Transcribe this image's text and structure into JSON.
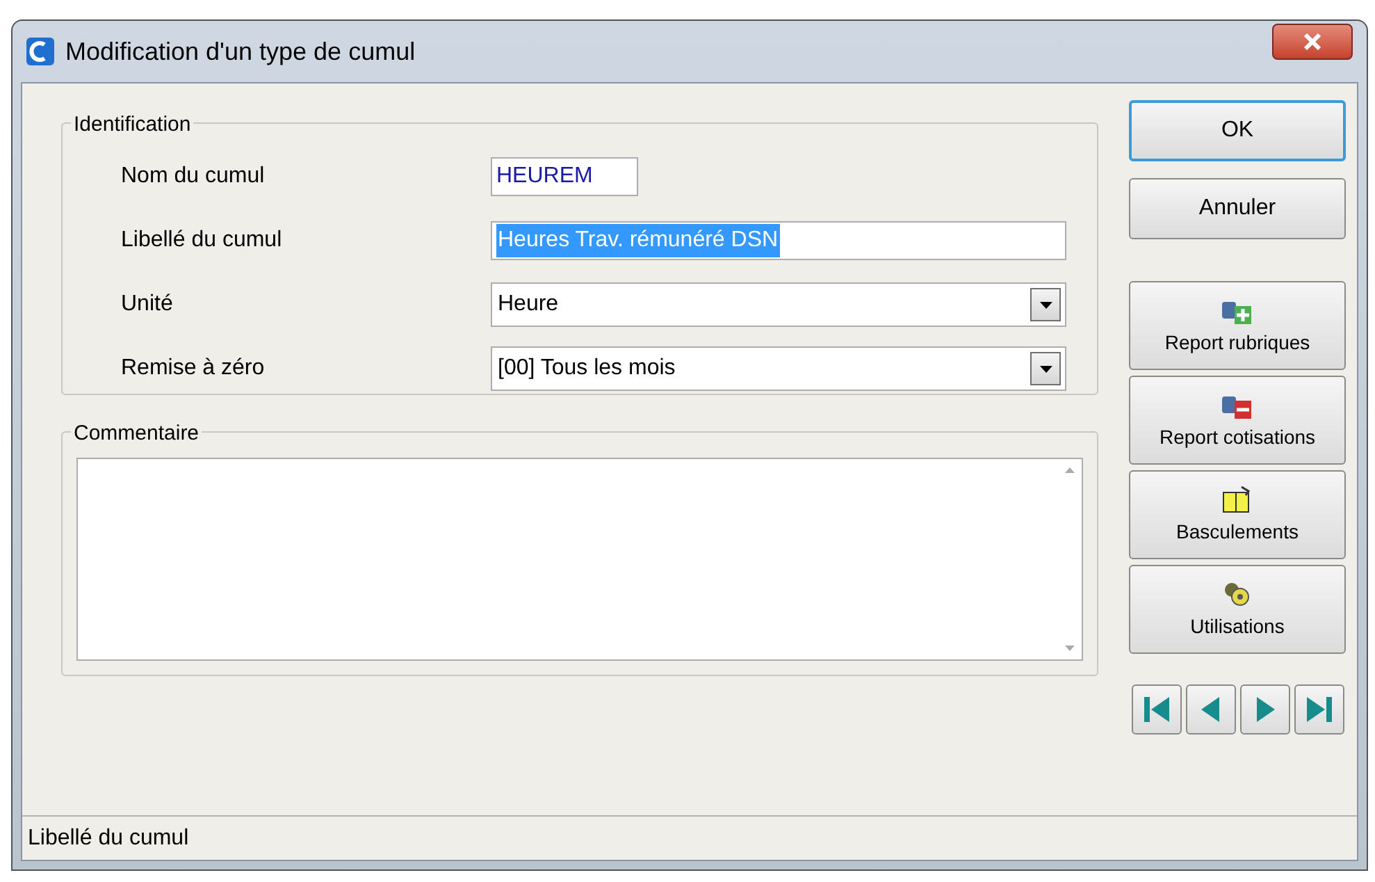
{
  "window": {
    "title": "Modification d'un type de cumul"
  },
  "identification": {
    "legend": "Identification",
    "fields": [
      {
        "kind": "text",
        "label": "Nom du cumul",
        "value": "HEUREM",
        "text_selected": false
      },
      {
        "kind": "text",
        "label": "Libellé du cumul",
        "value": "Heures Trav. rémunéré DSN",
        "text_selected": true
      },
      {
        "kind": "dropdown",
        "label": "Unité",
        "value": "Heure"
      },
      {
        "kind": "dropdown",
        "label": "Remise à zéro",
        "value": "[00] Tous les mois"
      }
    ]
  },
  "comment": {
    "legend": "Commentaire"
  },
  "buttons": [
    {
      "kind": "plain",
      "label": "OK",
      "default": true
    },
    {
      "kind": "plain",
      "label": "Annuler",
      "default": false
    },
    {
      "kind": "icon",
      "label": "Report rubriques"
    },
    {
      "kind": "icon",
      "label": "Report cotisations"
    },
    {
      "kind": "icon",
      "label": "Basculements"
    },
    {
      "kind": "icon",
      "label": "Utilisations"
    }
  ],
  "status_bar": {
    "text": "Libellé du cumul"
  }
}
